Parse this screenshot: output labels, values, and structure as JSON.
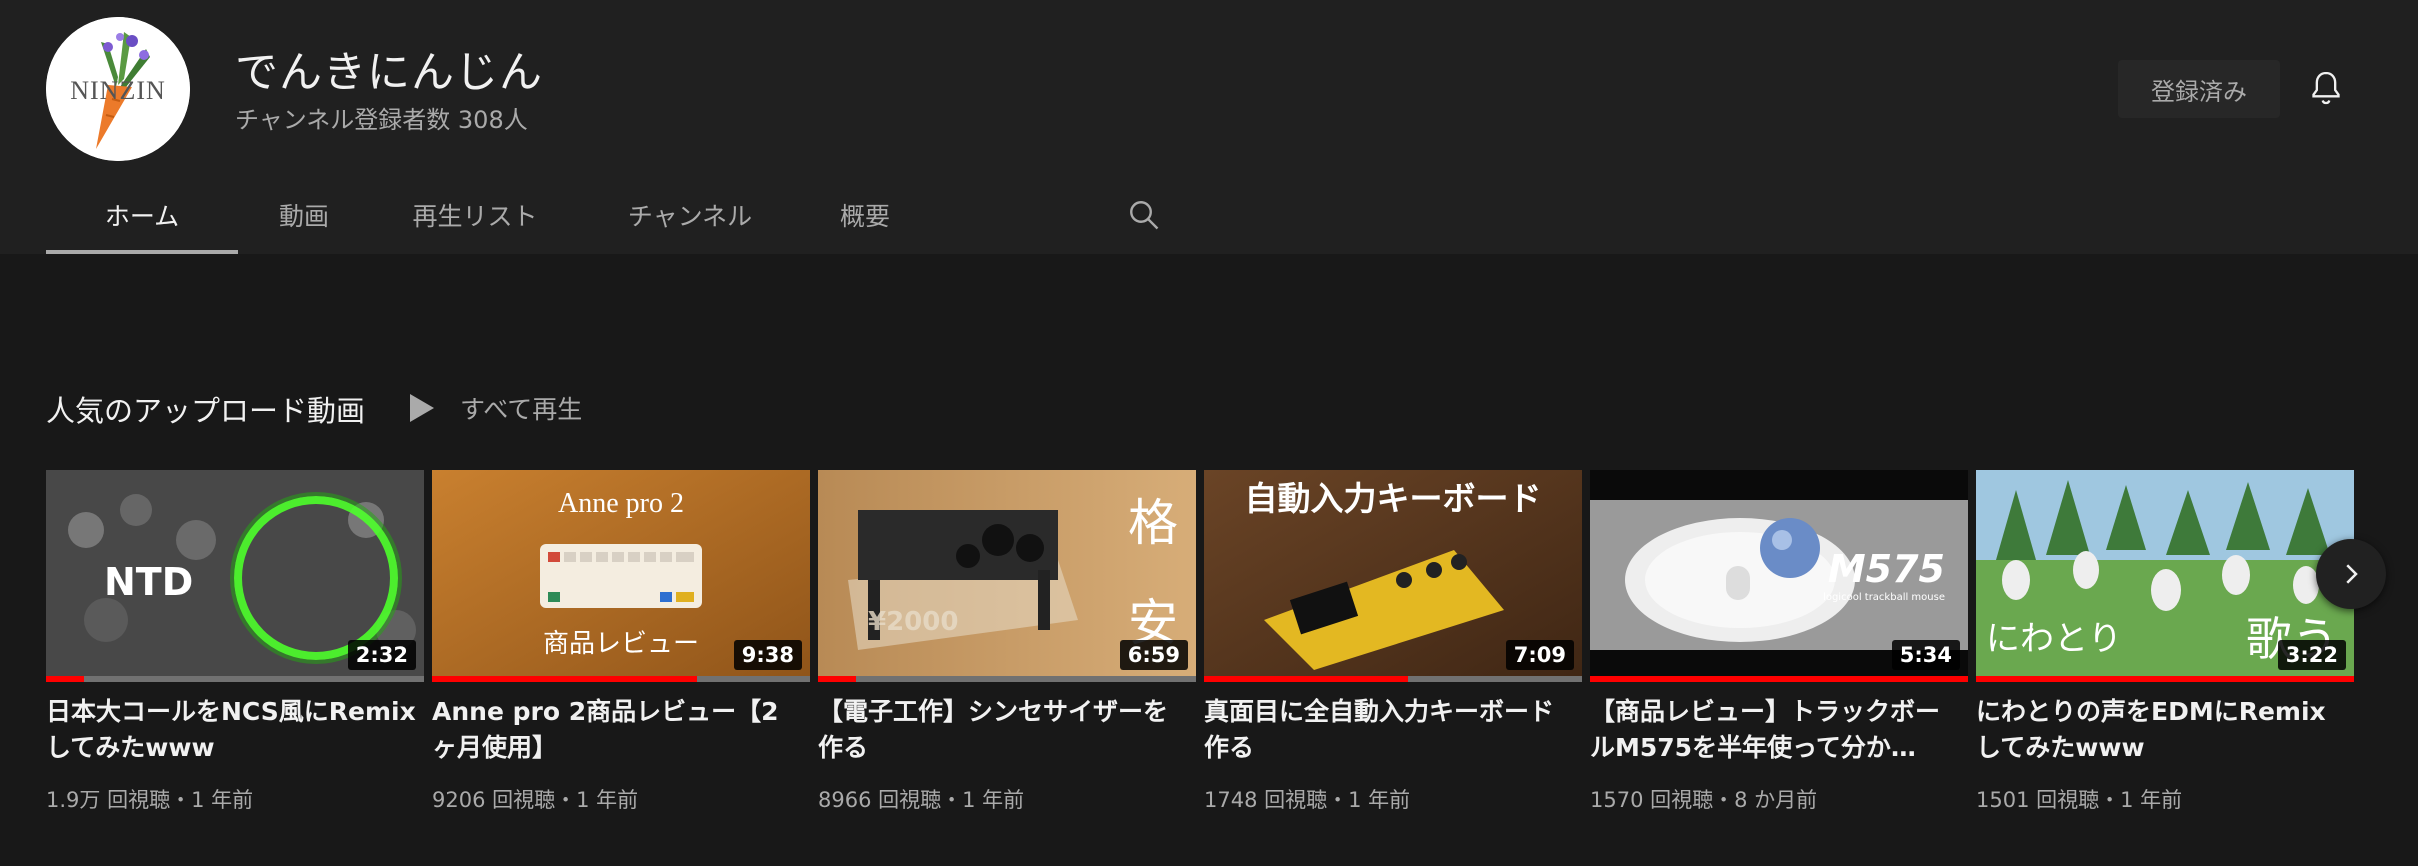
{
  "channel": {
    "name": "でんきにんじん",
    "subscribers": "チャンネル登録者数 308人",
    "subscribed_label": "登録済み",
    "avatar_text": "NINZIN"
  },
  "tabs": [
    {
      "label": "ホーム",
      "active": true
    },
    {
      "label": "動画",
      "active": false
    },
    {
      "label": "再生リスト",
      "active": false
    },
    {
      "label": "チャンネル",
      "active": false
    },
    {
      "label": "概要",
      "active": false
    }
  ],
  "section": {
    "title": "人気のアップロード動画",
    "play_all_label": "すべて再生"
  },
  "videos": [
    {
      "title": "日本大コールをNCS風にRemixしてみたwww",
      "meta": "1.9万 回視聴・1 年前",
      "duration": "2:32",
      "watched": 0.1,
      "thumb_text": "NTD"
    },
    {
      "title": "Anne pro 2商品レビュー【2ヶ月使用】",
      "meta": "9206 回視聴・1 年前",
      "duration": "9:38",
      "watched": 0.7,
      "thumb_text": "Anne pro 2",
      "thumb_text2": "商品レビュー"
    },
    {
      "title": "【電子工作】シンセサイザーを作る",
      "meta": "8966 回視聴・1 年前",
      "duration": "6:59",
      "watched": 0.1,
      "thumb_text": "格",
      "thumb_text2": "安",
      "thumb_text3": "¥2000"
    },
    {
      "title": "真面目に全自動入力キーボード作る",
      "meta": "1748 回視聴・1 年前",
      "duration": "7:09",
      "watched": 0.54,
      "thumb_text": "自動入力キーボード"
    },
    {
      "title": "【商品レビュー】トラックボールM575を半年使って分か…",
      "meta": "1570 回視聴・8 か月前",
      "duration": "5:34",
      "watched": 1.0,
      "thumb_text": "M575",
      "thumb_text2": "logicool trackball mouse"
    },
    {
      "title": "にわとりの声をEDMにRemixしてみたwww",
      "meta": "1501 回視聴・1 年前",
      "duration": "3:22",
      "watched": 1.0,
      "thumb_text": "にわとり",
      "thumb_text2": "歌う"
    }
  ],
  "icons": {
    "bell": "bell-icon",
    "search": "search-icon",
    "play": "play-icon",
    "next": "chevron-right-icon"
  }
}
